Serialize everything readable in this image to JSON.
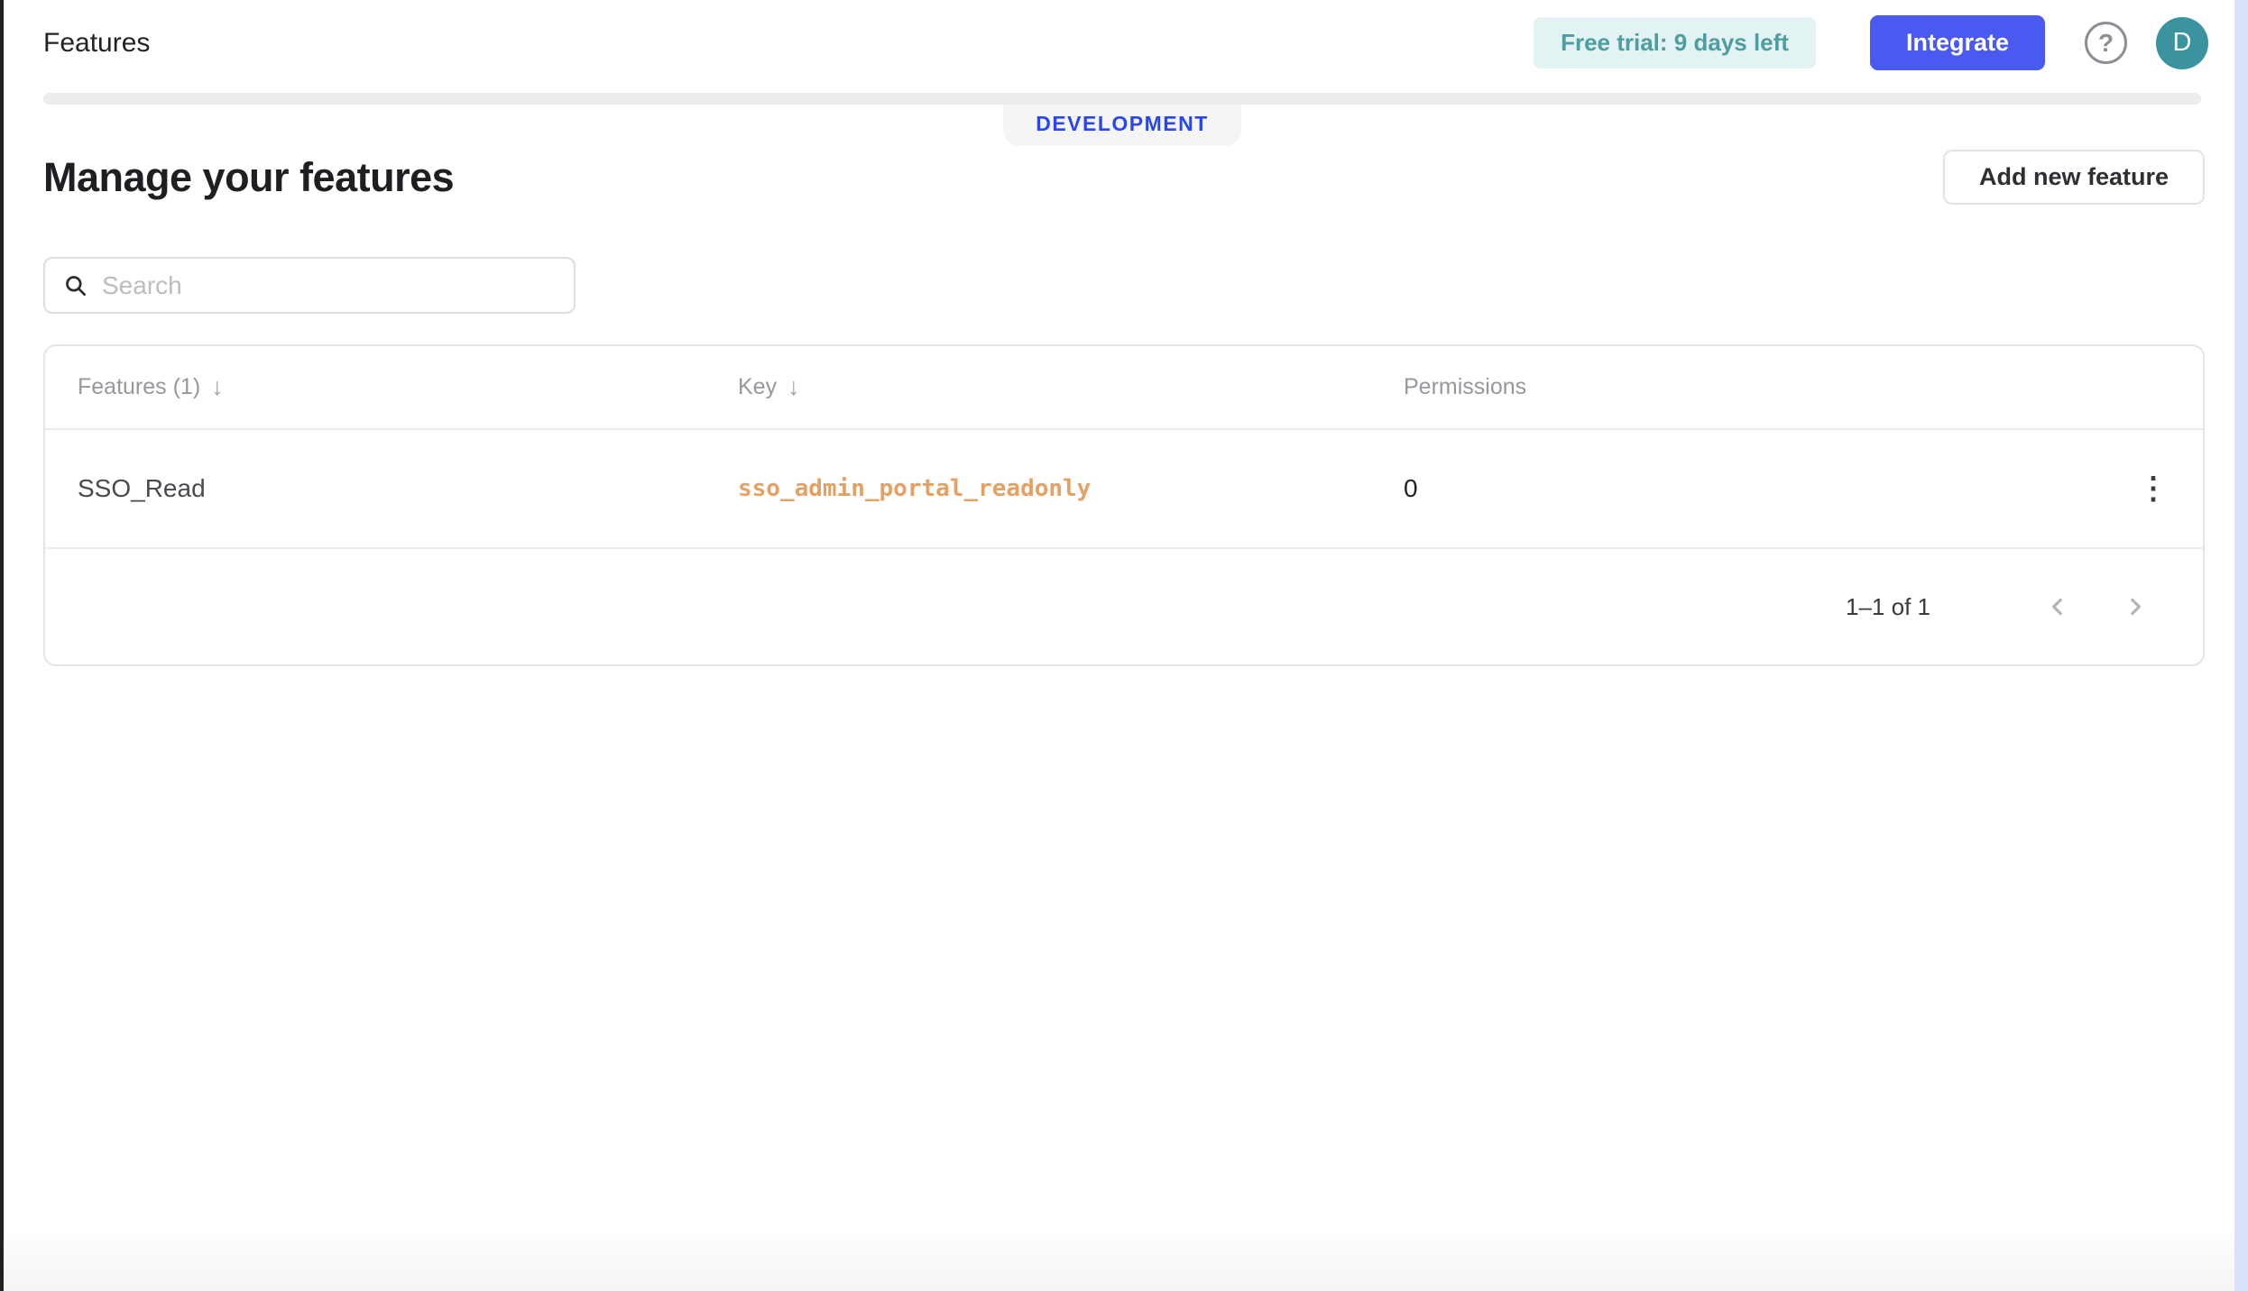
{
  "header": {
    "title": "Features",
    "trial_badge": "Free trial: 9 days left",
    "integrate_label": "Integrate",
    "avatar_initial": "D"
  },
  "environment": {
    "label": "DEVELOPMENT"
  },
  "page": {
    "heading": "Manage your features",
    "add_feature_label": "Add new feature"
  },
  "search": {
    "placeholder": "Search",
    "value": ""
  },
  "table": {
    "columns": [
      {
        "label": "Features (1)",
        "sortable": true
      },
      {
        "label": "Key",
        "sortable": true
      },
      {
        "label": "Permissions",
        "sortable": false
      }
    ],
    "rows": [
      {
        "feature": "SSO_Read",
        "key": "sso_admin_portal_readonly",
        "permissions": "0"
      }
    ],
    "pagination": {
      "range": "1–1 of 1"
    }
  },
  "icons": {
    "sort_down": "↓",
    "kebab": "⋮",
    "help": "?"
  },
  "colors": {
    "accent_blue": "#4a5af0",
    "environment_blue": "#2b46ee",
    "trial_badge_bg": "#e3f2f2",
    "trial_badge_text": "#4e9da0",
    "avatar_teal": "#3b93a0",
    "key_orange": "#e3a164",
    "scrollbar_track": "#d9e2f8"
  }
}
